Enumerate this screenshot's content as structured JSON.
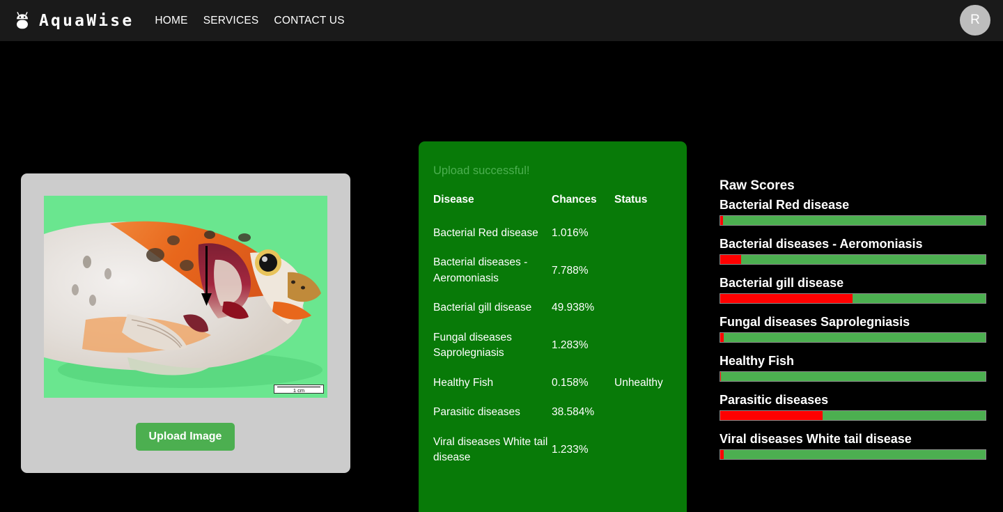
{
  "navbar": {
    "brand": "AquaWise",
    "brand_icon": "bug-logo-icon",
    "links": [
      {
        "label": "HOME"
      },
      {
        "label": "SERVICES"
      },
      {
        "label": "CONTACT US"
      }
    ],
    "avatar_initial": "R"
  },
  "upload_card": {
    "preview_alt": "fish-head-photo",
    "scalebar_label": "1 cm",
    "button_label": "Upload Image"
  },
  "results": {
    "status_message": "Upload successful!",
    "columns": {
      "disease": "Disease",
      "chances": "Chances",
      "status": "Status"
    },
    "rows": [
      {
        "disease": "Bacterial Red disease",
        "chances": "1.016%",
        "status": ""
      },
      {
        "disease": "Bacterial diseases - Aeromoniasis",
        "chances": "7.788%",
        "status": ""
      },
      {
        "disease": "Bacterial gill disease",
        "chances": "49.938%",
        "status": ""
      },
      {
        "disease": "Fungal diseases Saprolegniasis",
        "chances": "1.283%",
        "status": ""
      },
      {
        "disease": "Healthy Fish",
        "chances": "0.158%",
        "status": "Unhealthy"
      },
      {
        "disease": "Parasitic diseases",
        "chances": "38.584%",
        "status": ""
      },
      {
        "disease": "Viral diseases White tail disease",
        "chances": "1.233%",
        "status": ""
      }
    ]
  },
  "raw_scores": {
    "title": "Raw Scores",
    "items": [
      {
        "label": "Bacterial Red disease",
        "value": 1.016
      },
      {
        "label": "Bacterial diseases - Aeromoniasis",
        "value": 7.788
      },
      {
        "label": "Bacterial gill disease",
        "value": 49.938
      },
      {
        "label": "Fungal diseases Saprolegniasis",
        "value": 1.283
      },
      {
        "label": "Healthy Fish",
        "value": 0.158
      },
      {
        "label": "Parasitic diseases",
        "value": 38.584
      },
      {
        "label": "Viral diseases White tail disease",
        "value": 1.233
      }
    ]
  },
  "colors": {
    "navbar_bg": "#1a1a1a",
    "page_bg": "#000000",
    "panel_green": "#087A08",
    "accent_green": "#4CAF50",
    "bar_red": "#ff0000",
    "card_gray": "#cccccc"
  }
}
